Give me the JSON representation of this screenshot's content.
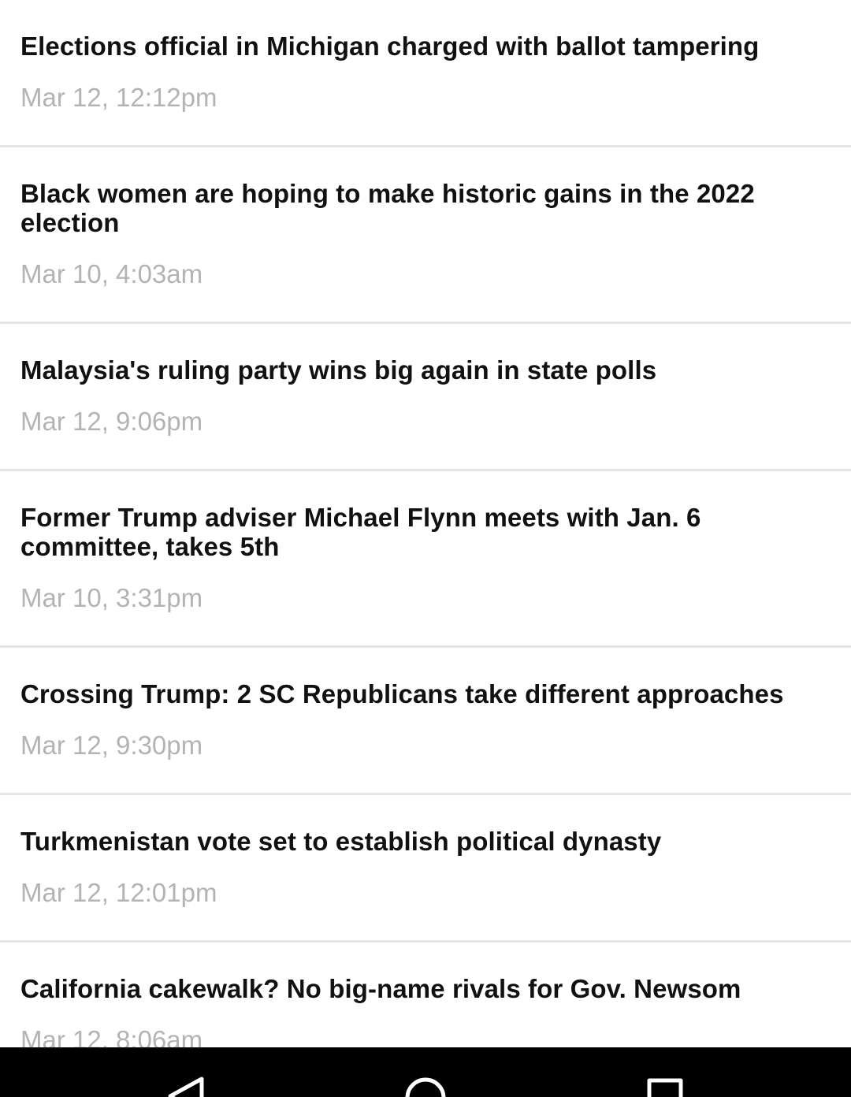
{
  "articles": [
    {
      "headline": "Elections official in Michigan charged with ballot tampering",
      "timestamp": "Mar 12, 12:12pm"
    },
    {
      "headline": "Black women are hoping to make historic gains in the 2022 election",
      "timestamp": "Mar 10, 4:03am"
    },
    {
      "headline": "Malaysia's ruling party wins big again in state polls",
      "timestamp": "Mar 12, 9:06pm"
    },
    {
      "headline": "Former Trump adviser Michael Flynn meets with Jan. 6 committee, takes 5th",
      "timestamp": "Mar 10, 3:31pm"
    },
    {
      "headline": "Crossing Trump: 2 SC Republicans take different approaches",
      "timestamp": "Mar 12, 9:30pm"
    },
    {
      "headline": "Turkmenistan vote set to establish political dynasty",
      "timestamp": "Mar 12, 12:01pm"
    },
    {
      "headline": "California cakewalk? No big-name rivals for Gov. Newsom",
      "timestamp": "Mar 12, 8:06am"
    }
  ],
  "system_nav": {
    "icons": [
      "back-icon",
      "home-icon",
      "recents-icon"
    ],
    "background": "#000000",
    "icon_color": "#ffffff"
  },
  "colors": {
    "headline": "#111111",
    "timestamp": "#b3b3b3",
    "divider": "#e6e6e6"
  }
}
